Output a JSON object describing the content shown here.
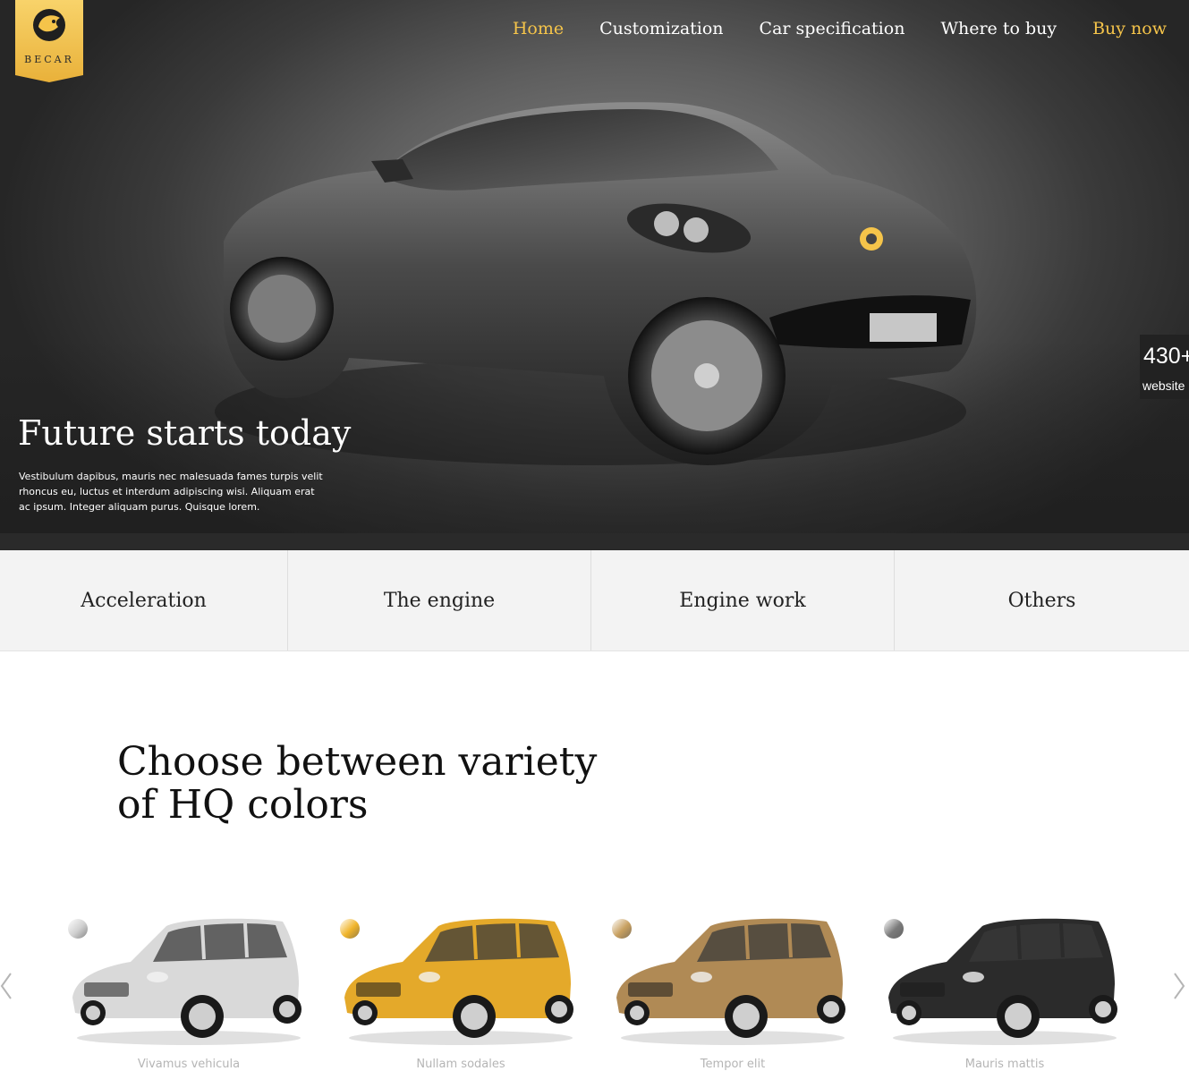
{
  "brand": {
    "logo_text": "BECAR",
    "accent_color": "#f5c44a"
  },
  "nav": {
    "items": [
      {
        "label": "Home"
      },
      {
        "label": "Customization"
      },
      {
        "label": "Car specification"
      },
      {
        "label": "Where to buy"
      },
      {
        "label": "Buy now"
      }
    ]
  },
  "hero": {
    "title": "Future starts today",
    "description": "Vestibulum dapibus, mauris nec malesuada fames turpis velit rhoncus eu, luctus et interdum adipiscing wisi. Aliquam erat ac ipsum. Integer aliquam purus. Quisque lorem."
  },
  "side_badge": {
    "number": "430+",
    "label": "website"
  },
  "tabs": [
    {
      "label": "Acceleration"
    },
    {
      "label": "The engine"
    },
    {
      "label": "Engine work"
    },
    {
      "label": "Others"
    }
  ],
  "colors_section": {
    "title": "Choose between variety of HQ colors",
    "cars": [
      {
        "name": "Vivamus vehicula",
        "color": "#d9d9d9",
        "swatch": "#cfcfcf"
      },
      {
        "name": "Nullam sodales",
        "color": "#e4a92a",
        "swatch": "#f0b42a"
      },
      {
        "name": "Tempor elit",
        "color": "#b08a55",
        "swatch": "#c8a060"
      },
      {
        "name": "Mauris mattis",
        "color": "#2b2b2b",
        "swatch": "#7a7a7a"
      }
    ]
  }
}
